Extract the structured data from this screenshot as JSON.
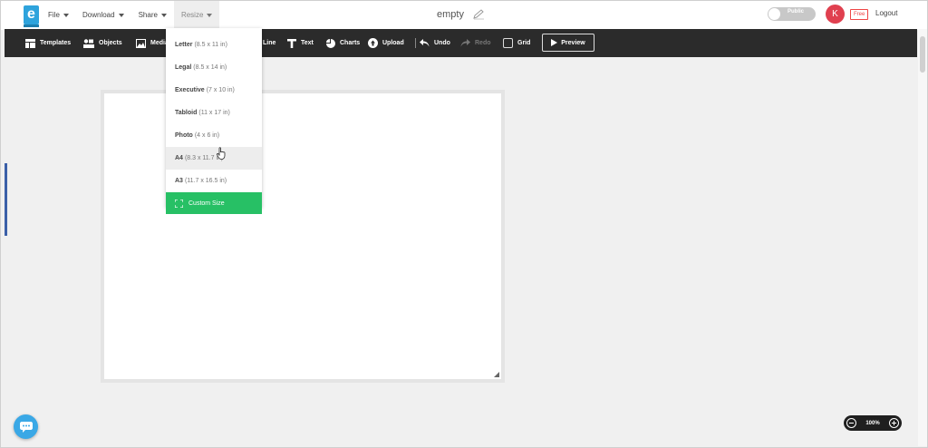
{
  "app": {
    "logo_letter": "e",
    "doc_title": "empty"
  },
  "menu": [
    {
      "label": "File"
    },
    {
      "label": "Download"
    },
    {
      "label": "Share"
    },
    {
      "label": "Resize"
    }
  ],
  "account": {
    "visibility_label": "Public",
    "avatar_initial": "K",
    "plan_badge": "Free",
    "logout_label": "Logout"
  },
  "toolbar": {
    "templates": "Templates",
    "objects": "Objects",
    "media": "Media",
    "line": "Line",
    "text": "Text",
    "charts": "Charts",
    "upload": "Upload",
    "undo": "Undo",
    "redo": "Redo",
    "grid": "Grid",
    "preview": "Preview"
  },
  "resize_menu": {
    "items": [
      {
        "name": "Letter",
        "size": "(8.5 x 11 in)"
      },
      {
        "name": "Legal",
        "size": "(8.5 x 14 in)"
      },
      {
        "name": "Executive",
        "size": "(7 x 10 in)"
      },
      {
        "name": "Tabloid",
        "size": "(11 x 17 in)"
      },
      {
        "name": "Photo",
        "size": "(4 x 6 in)"
      },
      {
        "name": "A4",
        "size": "(8.3 x 11.7 in)"
      },
      {
        "name": "A3",
        "size": "(11.7 x 16.5 in)"
      }
    ],
    "custom_label": "Custom Size",
    "hovered_index": 5
  },
  "zoom": {
    "value": "100%"
  },
  "colors": {
    "accent_green": "#27c065",
    "logo_blue": "#2ea3dc",
    "toolbar_bg": "#2b2b2b",
    "avatar_red": "#e0404f"
  }
}
